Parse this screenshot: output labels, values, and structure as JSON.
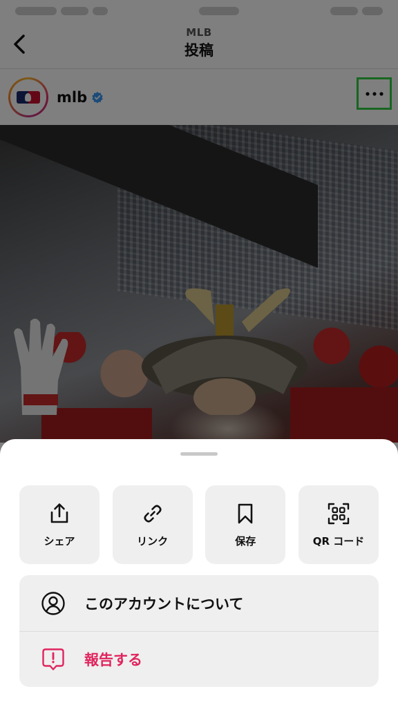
{
  "nav": {
    "subtitle": "MLB",
    "title": "投稿"
  },
  "post": {
    "username": "mlb",
    "verified": true
  },
  "sheet": {
    "actions": [
      {
        "label": "シェア",
        "icon": "share-icon"
      },
      {
        "label": "リンク",
        "icon": "link-icon"
      },
      {
        "label": "保存",
        "icon": "bookmark-icon"
      },
      {
        "label": "QR コード",
        "icon": "qr-code-icon"
      }
    ],
    "menu": [
      {
        "label": "このアカウントについて",
        "icon": "account-icon"
      },
      {
        "label": "報告する",
        "icon": "report-icon"
      }
    ]
  },
  "colors": {
    "danger": "#e0245e",
    "verified": "#3897f0",
    "highlight": "#2ecc40"
  }
}
